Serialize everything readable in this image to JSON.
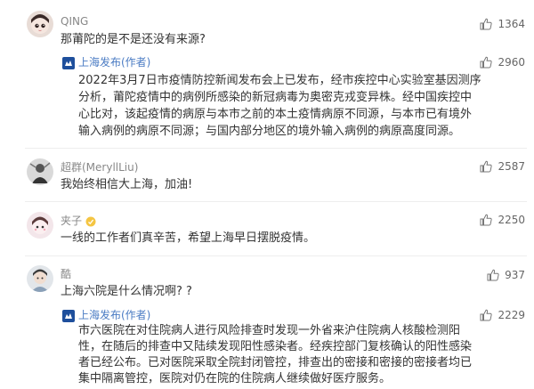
{
  "comments": [
    {
      "user": "QING",
      "text": "那莆陀的是不是还没有来源?",
      "likes": "1364",
      "reply": {
        "user": "上海发布(作者)",
        "text_lines": [
          "2022年3月7日市疫情防控新闻发布会上已发布，经市疾控中心实验室基因测序",
          "分析，莆陀疫情中的病例所感染的新冠病毒为奥密克戎变异株。经中国疾控中",
          "心比对，该起疫情的病原与本市之前的本土疫情病原不同源，与本市已有境外",
          "输入病例的病原不同源；与国内部分地区的境外输入病例的病原高度同源。"
        ],
        "likes": "2960"
      }
    },
    {
      "user": "超群(MeryllLiu)",
      "text": "我始终相信大上海，加油!",
      "likes": "2587"
    },
    {
      "user": "夹子",
      "text": "一线的工作者们真辛苦，希望上海早日摆脱疫情。",
      "likes": "2250"
    },
    {
      "user": "酷",
      "text": "上海六院是什么情况啊? ?",
      "likes": "937",
      "reply": {
        "user": "上海发布(作者)",
        "text_lines": [
          "市六医院在对住院病人进行风险排查时发现一外省来沪住院病人核酸检测阳",
          "性，在随后的排查中又陆续发现阳性感染者。经疾控部门复核确认的阳性感染",
          "者已经公布。已对医院采取全院封闭管控，排查出的密接和密接的密接者均已",
          "集中隔离管控，医院对仍在院的住院病人继续做好医疗服务。"
        ],
        "likes": "2229"
      }
    }
  ]
}
